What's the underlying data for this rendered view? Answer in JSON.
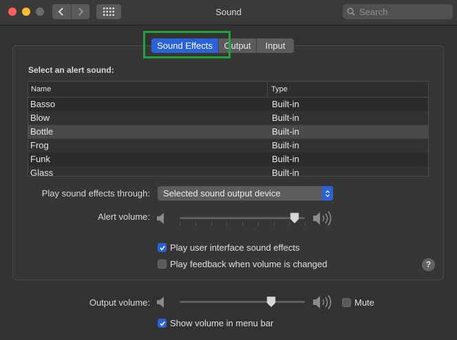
{
  "window": {
    "title": "Sound"
  },
  "search": {
    "placeholder": "Search"
  },
  "tabs": [
    {
      "label": "Sound Effects",
      "active": true
    },
    {
      "label": "Output",
      "active": false
    },
    {
      "label": "Input",
      "active": false
    }
  ],
  "alert_sounds": {
    "heading": "Select an alert sound:",
    "columns": [
      "Name",
      "Type"
    ],
    "rows": [
      {
        "name": "Basso",
        "type": "Built-in"
      },
      {
        "name": "Blow",
        "type": "Built-in"
      },
      {
        "name": "Bottle",
        "type": "Built-in",
        "selected": true
      },
      {
        "name": "Frog",
        "type": "Built-in"
      },
      {
        "name": "Funk",
        "type": "Built-in"
      },
      {
        "name": "Glass",
        "type": "Built-in"
      }
    ]
  },
  "play_through": {
    "label": "Play sound effects through:",
    "selected": "Selected sound output device"
  },
  "alert_volume": {
    "label": "Alert volume:",
    "level": 0.92
  },
  "options": {
    "ui_sounds": {
      "label": "Play user interface sound effects",
      "checked": true
    },
    "feedback": {
      "label": "Play feedback when volume is changed",
      "checked": false
    }
  },
  "output_volume": {
    "label": "Output volume:",
    "level": 0.73,
    "mute_label": "Mute",
    "muted": false
  },
  "menu_bar": {
    "label": "Show volume in menu bar",
    "checked": true
  },
  "help": {
    "symbol": "?"
  },
  "colors": {
    "accent": "#2a62d9",
    "highlight_box": "#1fa53a"
  }
}
